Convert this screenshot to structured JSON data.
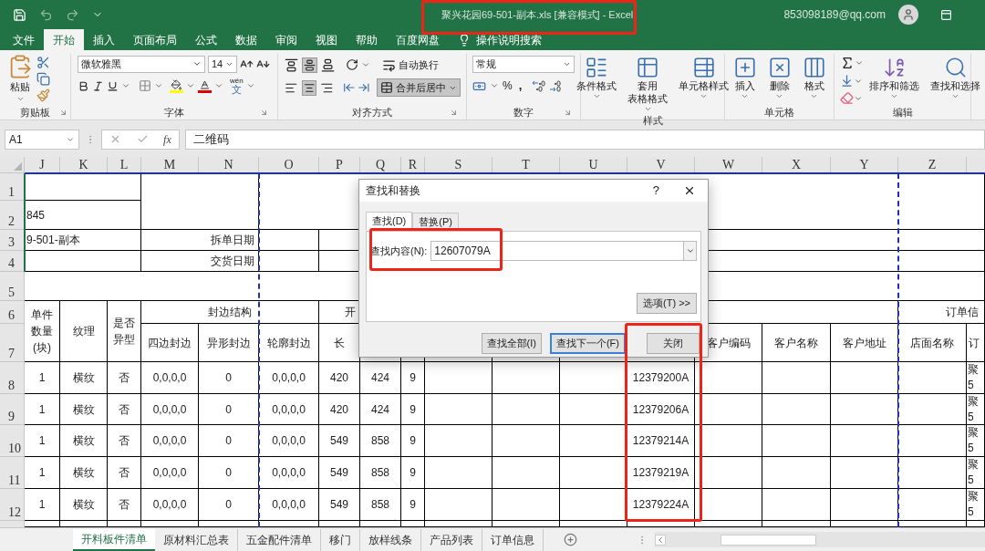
{
  "window": {
    "title": "聚兴花园69-501-副本.xls [兼容模式] - Excel",
    "account": "853098189@qq.com"
  },
  "ribbon_tabs": [
    {
      "label": "文件",
      "selected": false
    },
    {
      "label": "开始",
      "selected": true
    },
    {
      "label": "插入",
      "selected": false
    },
    {
      "label": "页面布局",
      "selected": false
    },
    {
      "label": "公式",
      "selected": false
    },
    {
      "label": "数据",
      "selected": false
    },
    {
      "label": "审阅",
      "selected": false
    },
    {
      "label": "视图",
      "selected": false
    },
    {
      "label": "帮助",
      "selected": false
    },
    {
      "label": "百度网盘",
      "selected": false
    }
  ],
  "tell_me": "操作说明搜索",
  "ribbon": {
    "clipboard": {
      "paste": "粘贴",
      "label": "剪贴板"
    },
    "font": {
      "name": "微软雅黑",
      "size": "14",
      "phonetic_top": "wén",
      "phonetic_bottom": "文",
      "label": "字体"
    },
    "alignment": {
      "vertical": [
        {
          "kind": "top",
          "selected": false
        },
        {
          "kind": "middle",
          "selected": true
        },
        {
          "kind": "bottom",
          "selected": false
        }
      ],
      "horizontal": [
        {
          "kind": "left",
          "selected": false
        },
        {
          "kind": "center",
          "selected": true
        },
        {
          "kind": "right",
          "selected": false
        }
      ],
      "wrap": "自动换行",
      "merge": {
        "label": "合并后居中",
        "selected": true
      },
      "label": "对齐方式"
    },
    "number": {
      "format": "常规",
      "percent": "%",
      "comma": ",",
      "label": "数字"
    },
    "styles": {
      "buttons": [
        {
          "lines": [
            "条件格式"
          ]
        },
        {
          "lines": [
            "套用",
            "表格格式"
          ]
        },
        {
          "lines": [
            "单元格样式"
          ]
        }
      ],
      "label": "样式"
    },
    "cells": {
      "buttons": [
        "插入",
        "删除",
        "格式"
      ],
      "label": "单元格"
    },
    "editing": {
      "sort": "排序和筛选",
      "find": "查找和选择",
      "label": "编辑"
    }
  },
  "formula_bar": {
    "name_box": "A1",
    "fx": "fx",
    "content": "二维码"
  },
  "sheet": {
    "column_headers": [
      "J",
      "K",
      "L",
      "M",
      "N",
      "O",
      "P",
      "Q",
      "R",
      "S",
      "T",
      "U",
      "V",
      "W",
      "X",
      "Y",
      "Z"
    ],
    "rows": [
      {
        "header": "1"
      },
      {
        "header": "2",
        "cells": [
          "845"
        ]
      },
      {
        "header": "3",
        "cells": [
          "9-501-副本",
          "拆单日期"
        ]
      },
      {
        "header": "4",
        "cells": [
          "交货日期"
        ]
      },
      {
        "header": "5"
      },
      {
        "header": "6",
        "cells": [
          "单件数量(块)",
          "纹理",
          "是否异型",
          "封边结构",
          "开",
          "订单信"
        ]
      },
      {
        "header": "7",
        "cells": [
          "四边封边",
          "异形封边",
          "轮廓封边",
          "长",
          "客户编码",
          "客户名称",
          "客户地址",
          "店面名称",
          "订"
        ]
      },
      {
        "header": "8",
        "cells": [
          "1",
          "横纹",
          "否",
          "0,0,0,0",
          "0",
          "0,0,0,0",
          "420",
          "424",
          "9",
          "12379200A",
          "聚",
          "5"
        ]
      },
      {
        "header": "9",
        "cells": [
          "1",
          "横纹",
          "否",
          "0,0,0,0",
          "0",
          "0,0,0,0",
          "420",
          "424",
          "9",
          "12379206A",
          "聚",
          "5"
        ]
      },
      {
        "header": "10",
        "cells": [
          "1",
          "横纹",
          "否",
          "0,0,0,0",
          "0",
          "0,0,0,0",
          "549",
          "858",
          "9",
          "12379214A",
          "聚",
          "5"
        ]
      },
      {
        "header": "11",
        "cells": [
          "1",
          "横纹",
          "否",
          "0,0,0,0",
          "0",
          "0,0,0,0",
          "549",
          "858",
          "9",
          "12379219A",
          "聚",
          "5"
        ]
      },
      {
        "header": "12",
        "cells": [
          "1",
          "横纹",
          "否",
          "0,0,0,0",
          "0",
          "0,0,0,0",
          "549",
          "858",
          "9",
          "12379224A",
          "聚",
          "5"
        ]
      }
    ]
  },
  "sheet_tabs": [
    {
      "label": "开料板件清单",
      "selected": true
    },
    {
      "label": "原材料汇总表",
      "selected": false
    },
    {
      "label": "五金配件清单",
      "selected": false
    },
    {
      "label": "移门",
      "selected": false
    },
    {
      "label": "放样线条",
      "selected": false
    },
    {
      "label": "产品列表",
      "selected": false
    },
    {
      "label": "订单信息",
      "selected": false
    }
  ],
  "dialog": {
    "title": "查找和替换",
    "help": "?",
    "tabs": [
      {
        "label": "查找(D)",
        "selected": true
      },
      {
        "label": "替换(P)",
        "selected": false
      }
    ],
    "find_label": "查找内容(N):",
    "find_value": "12607079A",
    "options": "选项(T) >>",
    "buttons": [
      {
        "label": "查找全部(I)",
        "focused": false
      },
      {
        "label": "查找下一个(F)",
        "focused": true
      },
      {
        "label": "关闭",
        "focused": false
      }
    ]
  }
}
